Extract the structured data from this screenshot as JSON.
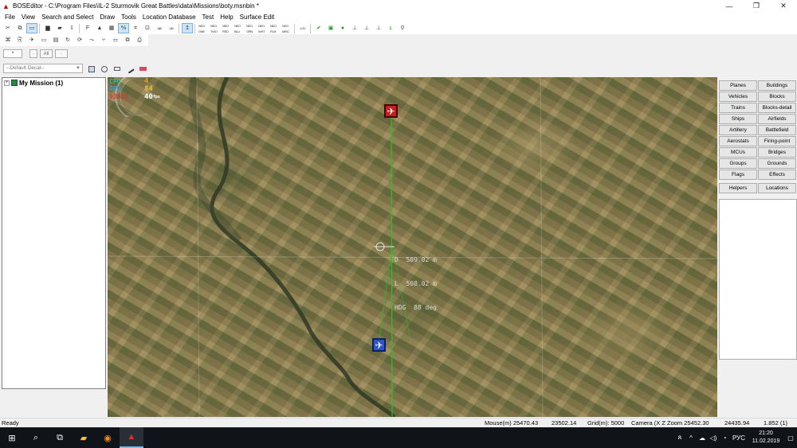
{
  "window": {
    "title": "BOSEditor - C:\\Program Files\\IL-2 Sturmovik Great Battles\\data\\Missions\\boty.msnbin *",
    "controls": {
      "minimize": "—",
      "maximize": "❐",
      "close": "✕"
    }
  },
  "menu": [
    "File",
    "View",
    "Search and Select",
    "Draw",
    "Tools",
    "Location Database",
    "Test",
    "Help",
    "Surface Edit"
  ],
  "toolbar1": {
    "buttons": [
      {
        "id": "cut",
        "glyph": "✂"
      },
      {
        "id": "copy",
        "glyph": "⧉"
      },
      {
        "id": "group",
        "glyph": "▭"
      },
      {
        "id": "save",
        "glyph": "▆"
      },
      {
        "id": "folder",
        "glyph": "▰"
      },
      {
        "id": "export",
        "glyph": "⇩"
      },
      {
        "id": "font",
        "glyph": "F"
      },
      {
        "id": "terrain",
        "glyph": "▲"
      },
      {
        "id": "grid",
        "glyph": "▦"
      },
      {
        "id": "ruler",
        "glyph": "⅍"
      },
      {
        "id": "frame",
        "glyph": "⌗"
      },
      {
        "id": "snap",
        "glyph": "⊡"
      },
      {
        "id": "ab",
        "glyph": "A|B"
      },
      {
        "id": "lb",
        "glyph": "L|B"
      },
      {
        "id": "height",
        "glyph": "↥"
      }
    ],
    "filter_buttons": [
      "NEO ONE",
      "NEO TWO",
      "NEO RED",
      "NEO BLU",
      "NEO GRN",
      "NEO WHT",
      "NEO FLM",
      "NEO MISC"
    ],
    "loc_label": "LOC",
    "misc_buttons": [
      {
        "id": "check",
        "glyph": "✔"
      },
      {
        "id": "frame-green",
        "glyph": "▣"
      },
      {
        "id": "dot",
        "glyph": "●"
      },
      {
        "id": "align1",
        "glyph": "⊥"
      },
      {
        "id": "align2",
        "glyph": "⊥"
      },
      {
        "id": "align3",
        "glyph": "⊥"
      },
      {
        "id": "pin",
        "glyph": "⍋"
      },
      {
        "id": "key",
        "glyph": "⚲"
      }
    ]
  },
  "toolbar2": {
    "buttons": [
      {
        "id": "nodes",
        "glyph": "⌘"
      },
      {
        "id": "link",
        "glyph": "⎘"
      },
      {
        "id": "wing",
        "glyph": "✈"
      },
      {
        "id": "img",
        "glyph": "▭"
      },
      {
        "id": "pic",
        "glyph": "▤"
      },
      {
        "id": "rotate",
        "glyph": "↻"
      },
      {
        "id": "cycle",
        "glyph": "⟳"
      },
      {
        "id": "path",
        "glyph": "⤳"
      },
      {
        "id": "branch",
        "glyph": "⑂"
      },
      {
        "id": "chart",
        "glyph": "⚏"
      },
      {
        "id": "copy2",
        "glyph": "⧉"
      },
      {
        "id": "paste",
        "glyph": "⎙"
      }
    ]
  },
  "layers": {
    "star": "*",
    "mid": "·",
    "all": "All",
    "more": "·"
  },
  "decal": {
    "placeholder": "--Default Decal--"
  },
  "tree": {
    "root": "My Mission (1)",
    "expander": "+"
  },
  "map": {
    "hud": {
      "left": [
        "CPU",
        "GPU",
        "03D11"
      ],
      "right": [
        "4",
        "84",
        "40"
      ],
      "fps_unit": "fps"
    },
    "readout": [
      "D  509.02 m",
      "L  508.02 m",
      "HDG  88 deg"
    ],
    "colors": {
      "route": "#27c427",
      "enemy": "#c81e1e",
      "friendly": "#2b56c8"
    }
  },
  "objects": {
    "categories": [
      [
        "Planes",
        "Buildings"
      ],
      [
        "Vehicles",
        "Blocks"
      ],
      [
        "Trains",
        "Blocks-detail"
      ],
      [
        "Ships",
        "Airfields"
      ],
      [
        "Artillery",
        "Battlefield"
      ],
      [
        "Aerostats",
        "Firing-point"
      ],
      [
        "MCUs",
        "Bridges"
      ],
      [
        "Groups",
        "Grounds"
      ],
      [
        "Flags",
        "Effects"
      ]
    ],
    "extra": [
      "Helpers",
      "Locations"
    ]
  },
  "status": {
    "ready": "Ready",
    "mouse": "Mouse(m)  25470.43",
    "mouse_y": "23502.14",
    "grid": "Grid(m): 5000",
    "camera": "Camera (X  Z  Zoom 25452.30",
    "cam_y": "24435.94",
    "zoom": "1.852 (1)"
  },
  "taskbar": {
    "icons": [
      "⊞",
      "⌕",
      "⧉",
      "▰",
      "◉",
      "▲"
    ],
    "tray": {
      "people": "ጸ",
      "chevron": "^",
      "net": "☁",
      "sound": "◁)",
      "wifi": "◔",
      "lang": "РУС"
    },
    "time": "21:20",
    "date": "11.02.2019"
  }
}
